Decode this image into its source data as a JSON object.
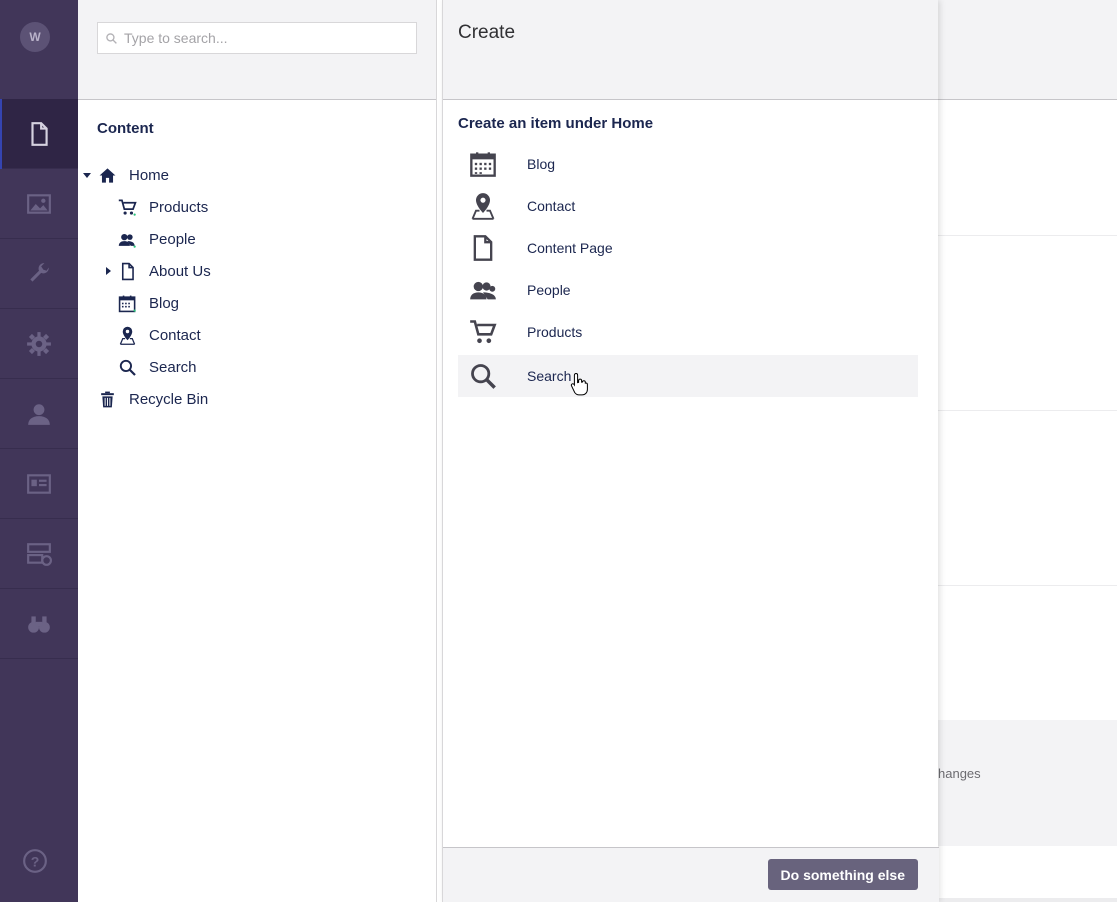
{
  "rail": {
    "avatar_initial": "W",
    "sections": [
      {
        "name": "content",
        "icon": "document-icon",
        "active": true
      },
      {
        "name": "media",
        "icon": "picture-icon",
        "active": false
      },
      {
        "name": "settings",
        "icon": "wrench-icon",
        "active": false
      },
      {
        "name": "developer",
        "icon": "gear-icon",
        "active": false
      },
      {
        "name": "users",
        "icon": "user-icon",
        "active": false
      },
      {
        "name": "members",
        "icon": "id-card-icon",
        "active": false
      },
      {
        "name": "forms",
        "icon": "server-add-icon",
        "active": false
      },
      {
        "name": "translation",
        "icon": "binoculars-icon",
        "active": false
      }
    ],
    "help_icon": "help-icon"
  },
  "tree": {
    "search_placeholder": "Type to search...",
    "title": "Content",
    "nodes": [
      {
        "label": "Home",
        "icon": "home-icon",
        "expanded": true
      },
      {
        "label": "Products",
        "icon": "cart-icon"
      },
      {
        "label": "People",
        "icon": "people-icon"
      },
      {
        "label": "About Us",
        "icon": "document-icon",
        "has_children": true
      },
      {
        "label": "Blog",
        "icon": "calendar-icon"
      },
      {
        "label": "Contact",
        "icon": "map-pin-icon"
      },
      {
        "label": "Search",
        "icon": "search-icon"
      },
      {
        "label": "Recycle Bin",
        "icon": "trash-icon"
      }
    ]
  },
  "create": {
    "title": "Create",
    "subtitle": "Create an item under Home",
    "items": [
      {
        "label": "Blog",
        "icon": "calendar-icon"
      },
      {
        "label": "Contact",
        "icon": "map-pin-icon"
      },
      {
        "label": "Content Page",
        "icon": "document-icon"
      },
      {
        "label": "People",
        "icon": "people-icon"
      },
      {
        "label": "Products",
        "icon": "cart-icon"
      },
      {
        "label": "Search",
        "icon": "search-icon",
        "hovered": true
      }
    ],
    "footer_button": "Do something else"
  },
  "background": {
    "changes_text": "hanges"
  },
  "colors": {
    "rail": "#413659",
    "rail_active": "#2f2545",
    "panel_header": "#f3f3f5",
    "text": "#1b264f",
    "button": "#68637d"
  }
}
